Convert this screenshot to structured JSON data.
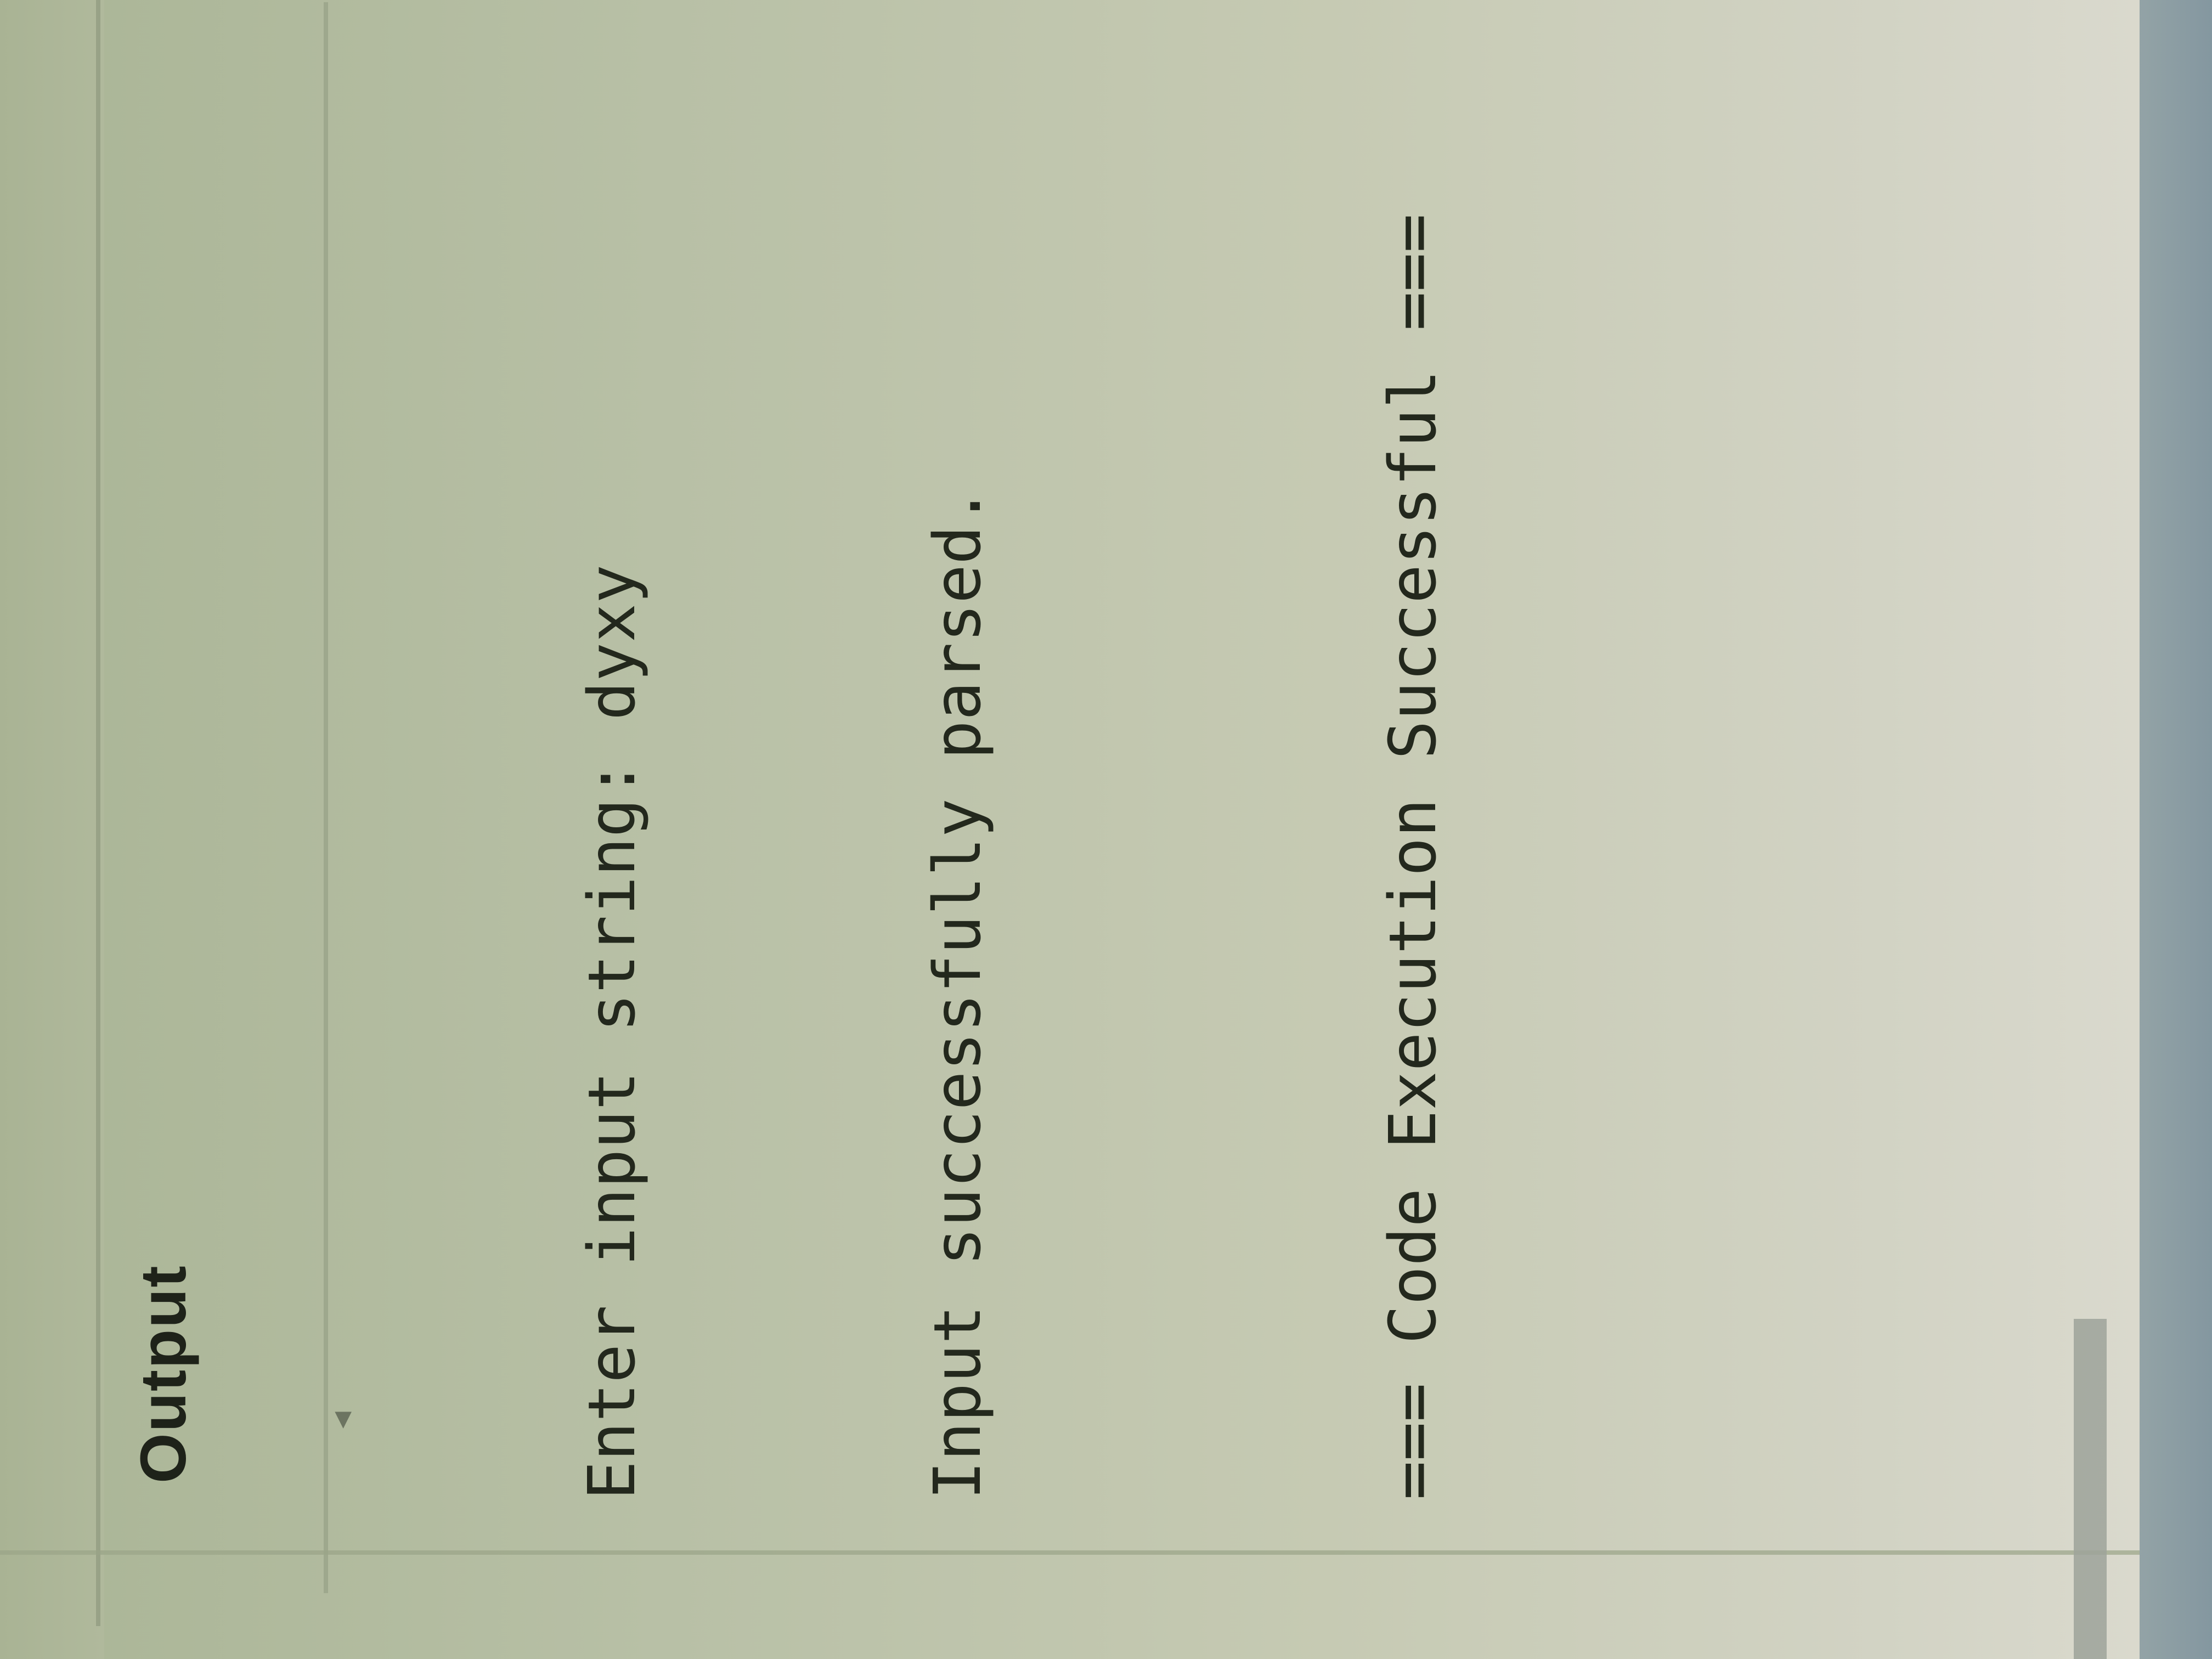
{
  "panel": {
    "title": "Output"
  },
  "console": {
    "lines": [
      "Enter input string: dyxy",
      "Input successfully parsed.",
      "=== Code Execution Successful ==="
    ]
  },
  "icons": {
    "collapse": "caret-left-icon"
  },
  "colors": {
    "text": "#23281d",
    "background": "#c6cab3",
    "status_bar": "#8a9ca3"
  }
}
